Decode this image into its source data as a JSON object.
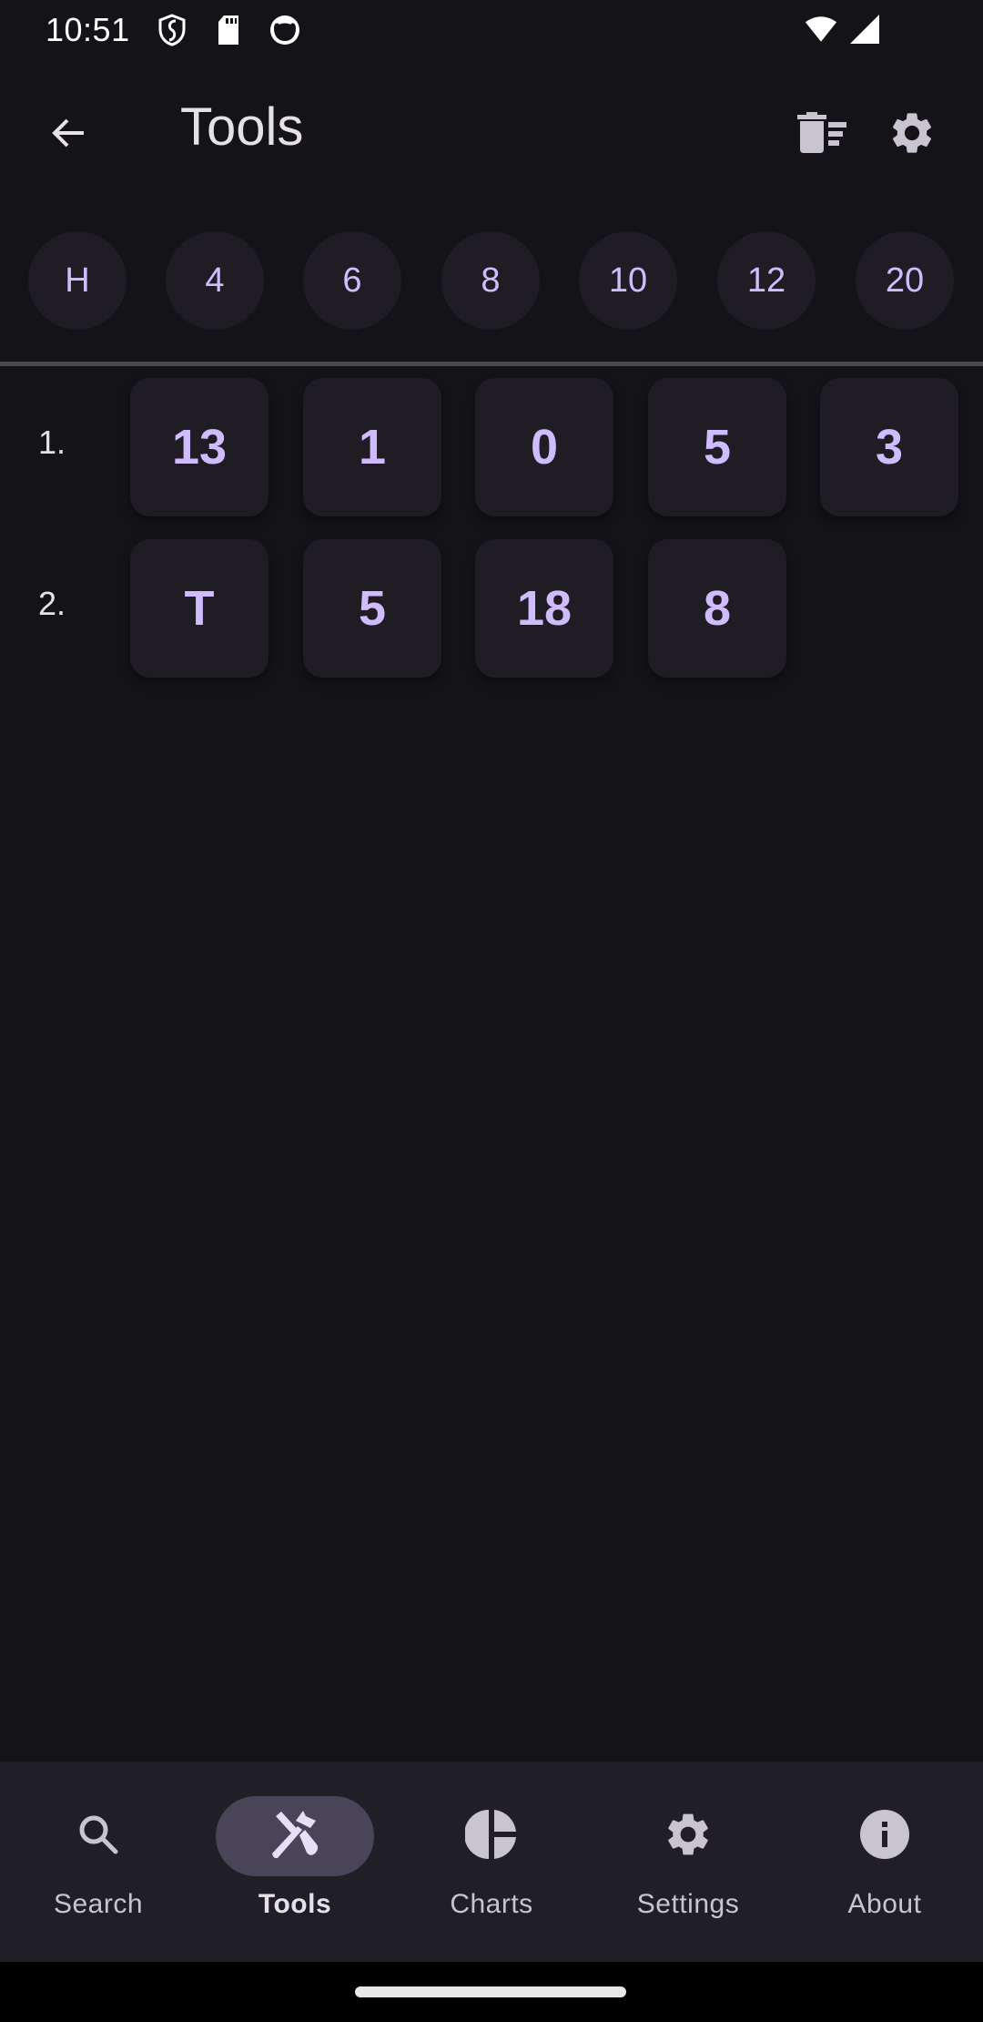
{
  "status_bar": {
    "time": "10:51",
    "left_icons": [
      "shield-icon",
      "sd-card-icon",
      "cat-face-icon"
    ],
    "right_icons": [
      "wifi-icon",
      "cellular-signal-icon"
    ]
  },
  "app_bar": {
    "title": "Tools",
    "back_icon": "arrow-back-icon",
    "actions": [
      {
        "name": "clear-history",
        "icon": "delete-sweep-icon"
      },
      {
        "name": "settings",
        "icon": "gear-icon"
      }
    ]
  },
  "dice": [
    {
      "label": "H"
    },
    {
      "label": "4"
    },
    {
      "label": "6"
    },
    {
      "label": "8"
    },
    {
      "label": "10"
    },
    {
      "label": "12"
    },
    {
      "label": "20"
    }
  ],
  "rolls": [
    {
      "label": "1.",
      "values": [
        "13",
        "1",
        "0",
        "5",
        "3"
      ]
    },
    {
      "label": "2.",
      "values": [
        "T",
        "5",
        "18",
        "8"
      ]
    }
  ],
  "bottom_nav": {
    "items": [
      {
        "label": "Search",
        "icon": "search-icon",
        "active": false
      },
      {
        "label": "Tools",
        "icon": "tools-icon",
        "active": true
      },
      {
        "label": "Charts",
        "icon": "pie-chart-icon",
        "active": false
      },
      {
        "label": "Settings",
        "icon": "gear-icon",
        "active": false
      },
      {
        "label": "About",
        "icon": "info-icon",
        "active": false
      }
    ]
  },
  "colors": {
    "background": "#141318",
    "surface": "#1f1d23",
    "accent": "#cfbcff",
    "nav_background": "#211f26",
    "nav_active_pill": "#4a4458"
  }
}
